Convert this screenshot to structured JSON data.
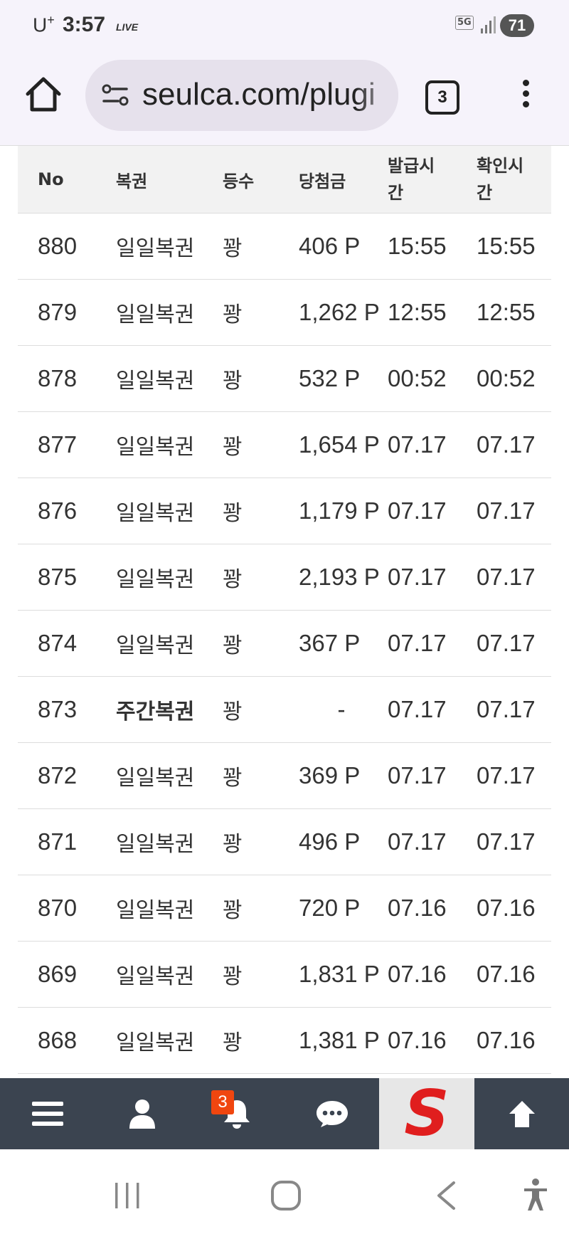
{
  "status_bar": {
    "carrier": "U",
    "carrier_sup": "+",
    "time": "3:57",
    "live_label": "LIVE",
    "network": "5G",
    "battery": "71"
  },
  "browser": {
    "url": "seulca.com/plugi",
    "tab_count": "3"
  },
  "table": {
    "headers": {
      "no": "No",
      "type": "복권",
      "rank": "등수",
      "prize": "당첨금",
      "issue_time_1": "발급시",
      "issue_time_2": "간",
      "check_time_1": "확인시",
      "check_time_2": "간"
    },
    "rows": [
      {
        "no": "880",
        "type": "일일복권",
        "rank": "꽝",
        "prize": "406 P",
        "issue": "15:55",
        "check": "15:55"
      },
      {
        "no": "879",
        "type": "일일복권",
        "rank": "꽝",
        "prize": "1,262 P",
        "issue": "12:55",
        "check": "12:55"
      },
      {
        "no": "878",
        "type": "일일복권",
        "rank": "꽝",
        "prize": "532 P",
        "issue": "00:52",
        "check": "00:52"
      },
      {
        "no": "877",
        "type": "일일복권",
        "rank": "꽝",
        "prize": "1,654 P",
        "issue": "07.17",
        "check": "07.17"
      },
      {
        "no": "876",
        "type": "일일복권",
        "rank": "꽝",
        "prize": "1,179 P",
        "issue": "07.17",
        "check": "07.17"
      },
      {
        "no": "875",
        "type": "일일복권",
        "rank": "꽝",
        "prize": "2,193 P",
        "issue": "07.17",
        "check": "07.17"
      },
      {
        "no": "874",
        "type": "일일복권",
        "rank": "꽝",
        "prize": "367 P",
        "issue": "07.17",
        "check": "07.17"
      },
      {
        "no": "873",
        "type": "주간복권",
        "rank": "꽝",
        "prize": "-",
        "issue": "07.17",
        "check": "07.17"
      },
      {
        "no": "872",
        "type": "일일복권",
        "rank": "꽝",
        "prize": "369 P",
        "issue": "07.17",
        "check": "07.17"
      },
      {
        "no": "871",
        "type": "일일복권",
        "rank": "꽝",
        "prize": "496 P",
        "issue": "07.17",
        "check": "07.17"
      },
      {
        "no": "870",
        "type": "일일복권",
        "rank": "꽝",
        "prize": "720 P",
        "issue": "07.16",
        "check": "07.16"
      },
      {
        "no": "869",
        "type": "일일복권",
        "rank": "꽝",
        "prize": "1,831 P",
        "issue": "07.16",
        "check": "07.16"
      },
      {
        "no": "868",
        "type": "일일복권",
        "rank": "꽝",
        "prize": "1,381 P",
        "issue": "07.16",
        "check": "07.16"
      }
    ]
  },
  "bottom_nav": {
    "notification_count": "3",
    "logo_letter": "S"
  },
  "colors": {
    "nav_bg": "#3b4450",
    "badge": "#f0460f",
    "logo_red": "#e01e1e"
  }
}
